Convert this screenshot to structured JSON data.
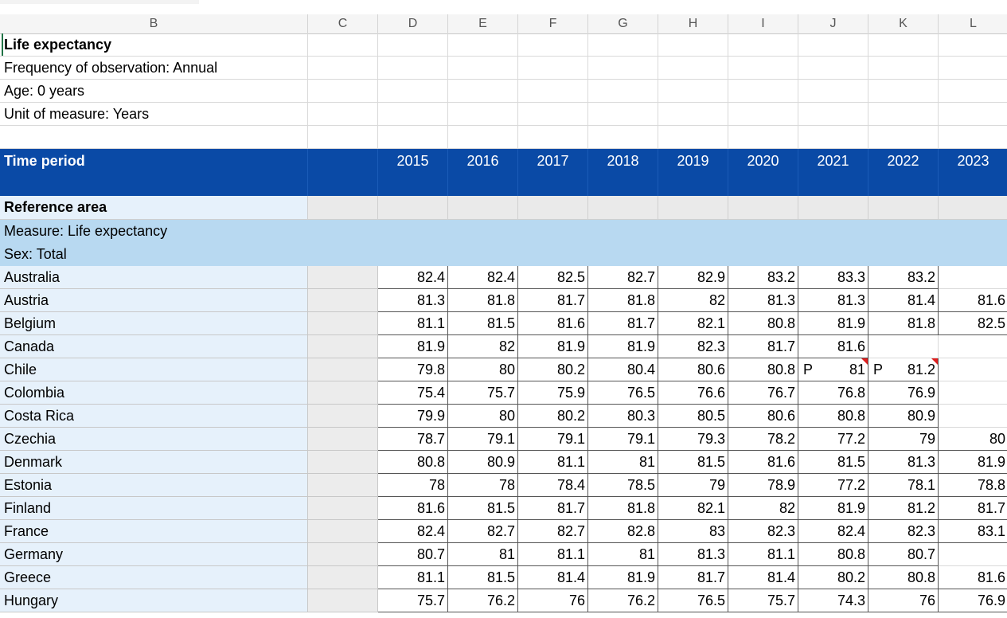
{
  "columns": [
    "B",
    "C",
    "D",
    "E",
    "F",
    "G",
    "H",
    "I",
    "J",
    "K",
    "L"
  ],
  "sheet": {
    "title": "Life expectancy",
    "frequency": "Frequency of observation: Annual",
    "age": "Age: 0 years",
    "unit": "Unit of measure: Years"
  },
  "header": {
    "time_period_label": "Time period",
    "years": [
      "2015",
      "2016",
      "2017",
      "2018",
      "2019",
      "2020",
      "2021",
      "2022",
      "2023"
    ]
  },
  "reference_area_label": "Reference area",
  "measure_label": "Measure: Life expectancy",
  "sex_label": "Sex: Total",
  "rows": [
    {
      "country": "Australia",
      "values": [
        "82.4",
        "82.4",
        "82.5",
        "82.7",
        "82.9",
        "83.2",
        "83.3",
        "83.2",
        ""
      ]
    },
    {
      "country": "Austria",
      "values": [
        "81.3",
        "81.8",
        "81.7",
        "81.8",
        "82",
        "81.3",
        "81.3",
        "81.4",
        "81.6"
      ]
    },
    {
      "country": "Belgium",
      "values": [
        "81.1",
        "81.5",
        "81.6",
        "81.7",
        "82.1",
        "80.8",
        "81.9",
        "81.8",
        "82.5"
      ]
    },
    {
      "country": "Canada",
      "values": [
        "81.9",
        "82",
        "81.9",
        "81.9",
        "82.3",
        "81.7",
        "81.6",
        "",
        ""
      ]
    },
    {
      "country": "Chile",
      "values": [
        "79.8",
        "80",
        "80.2",
        "80.4",
        "80.6",
        "80.8",
        "81",
        "81.2",
        ""
      ],
      "flags": {
        "6": "P",
        "7": "P"
      }
    },
    {
      "country": "Colombia",
      "values": [
        "75.4",
        "75.7",
        "75.9",
        "76.5",
        "76.6",
        "76.7",
        "76.8",
        "76.9",
        ""
      ]
    },
    {
      "country": "Costa Rica",
      "values": [
        "79.9",
        "80",
        "80.2",
        "80.3",
        "80.5",
        "80.6",
        "80.8",
        "80.9",
        ""
      ]
    },
    {
      "country": "Czechia",
      "values": [
        "78.7",
        "79.1",
        "79.1",
        "79.1",
        "79.3",
        "78.2",
        "77.2",
        "79",
        "80"
      ]
    },
    {
      "country": "Denmark",
      "values": [
        "80.8",
        "80.9",
        "81.1",
        "81",
        "81.5",
        "81.6",
        "81.5",
        "81.3",
        "81.9"
      ]
    },
    {
      "country": "Estonia",
      "values": [
        "78",
        "78",
        "78.4",
        "78.5",
        "79",
        "78.9",
        "77.2",
        "78.1",
        "78.8"
      ]
    },
    {
      "country": "Finland",
      "values": [
        "81.6",
        "81.5",
        "81.7",
        "81.8",
        "82.1",
        "82",
        "81.9",
        "81.2",
        "81.7"
      ]
    },
    {
      "country": "France",
      "values": [
        "82.4",
        "82.7",
        "82.7",
        "82.8",
        "83",
        "82.3",
        "82.4",
        "82.3",
        "83.1"
      ]
    },
    {
      "country": "Germany",
      "values": [
        "80.7",
        "81",
        "81.1",
        "81",
        "81.3",
        "81.1",
        "80.8",
        "80.7",
        ""
      ]
    },
    {
      "country": "Greece",
      "values": [
        "81.1",
        "81.5",
        "81.4",
        "81.9",
        "81.7",
        "81.4",
        "80.2",
        "80.8",
        "81.6"
      ]
    },
    {
      "country": "Hungary",
      "values": [
        "75.7",
        "76.2",
        "76",
        "76.2",
        "76.5",
        "75.7",
        "74.3",
        "76",
        "76.9"
      ]
    }
  ]
}
